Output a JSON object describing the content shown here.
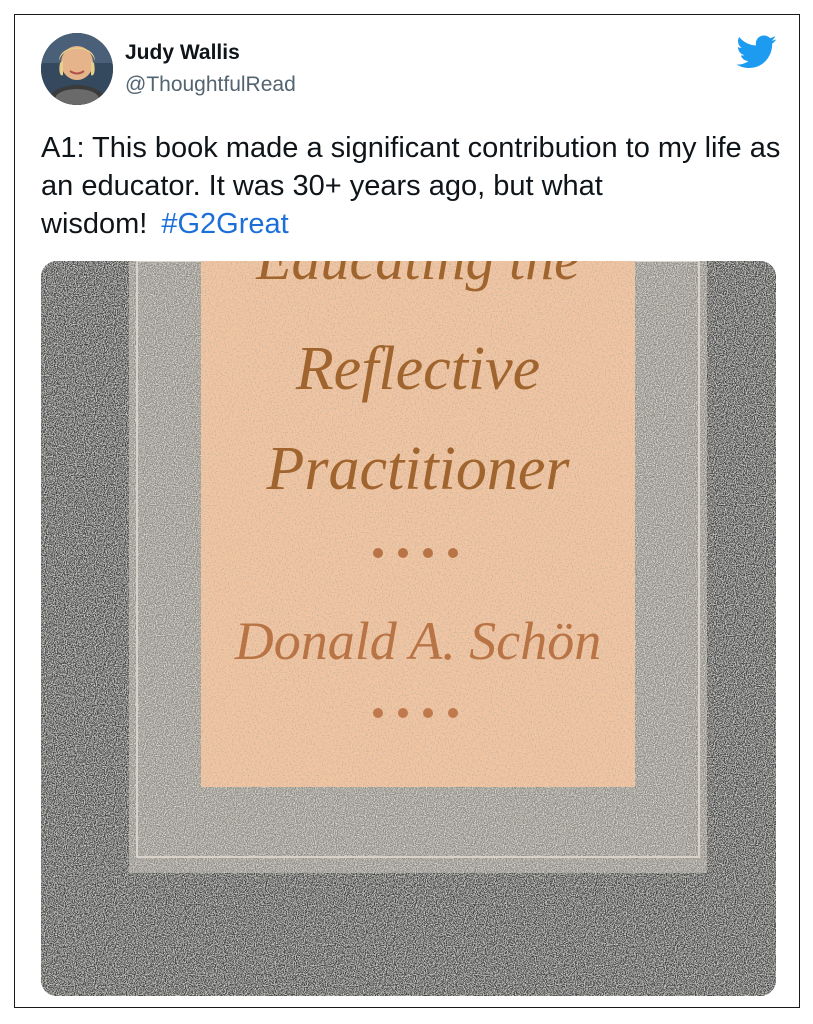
{
  "author": {
    "name": "Judy Wallis",
    "handle": "@ThoughtfulRead",
    "avatar_icon": "profile-photo"
  },
  "platform_icon": "twitter-bird-icon",
  "tweet": {
    "text": "A1: This book made a significant contribution to my life as an educator. It was 30+ years ago, but what wisdom!",
    "hashtag": "#G2Great"
  },
  "media": {
    "cover_title_line1": "Educating the",
    "cover_title_line2": "Reflective",
    "cover_title_line3": "Practitioner",
    "cover_author": "Donald A. Schön"
  },
  "colors": {
    "hashtag": "#1d6fd8",
    "twitter_blue": "#1d9bf0",
    "cover_panel": "#f3c6a3",
    "cover_text": "#a0652e"
  }
}
